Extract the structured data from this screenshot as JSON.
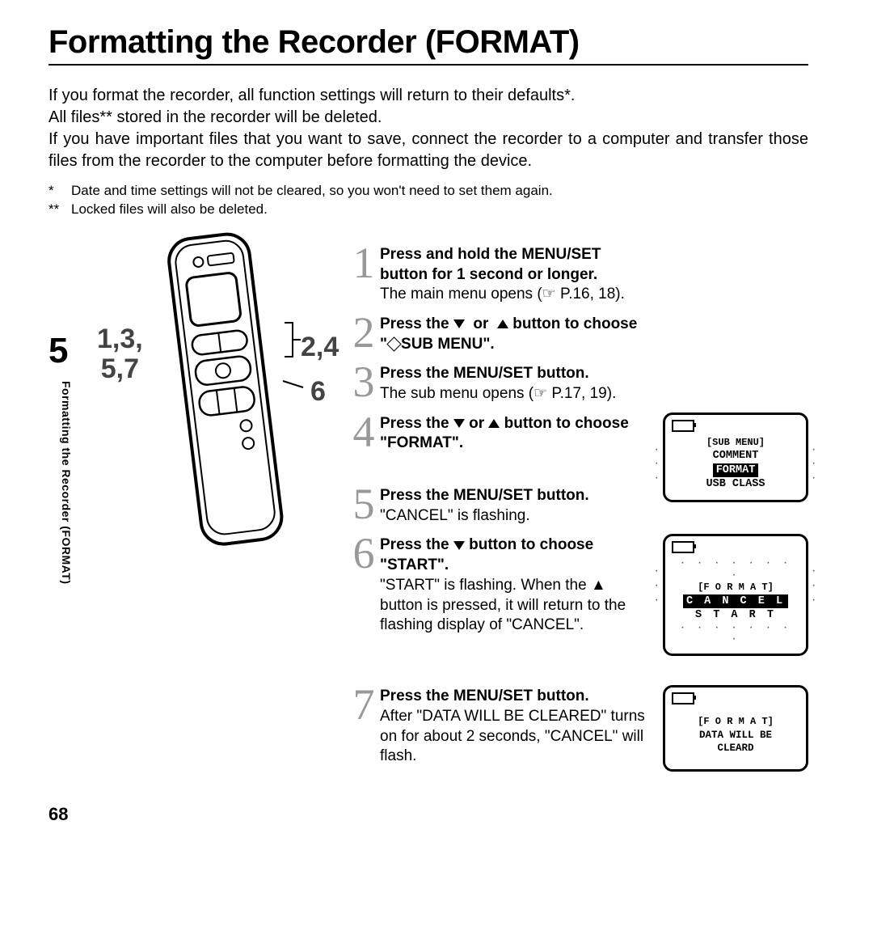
{
  "title": "Formatting the Recorder (FORMAT)",
  "intro_lines": [
    "If you format the recorder, all function settings will return to their defaults*.",
    "All files** stored in the recorder will be deleted.",
    "If you have important files that you want to save, connect the recorder to a computer and transfer those files from the recorder to the computer before formatting the device."
  ],
  "footnotes": [
    {
      "mark": "*",
      "text": "Date and time settings will not be cleared, so you won't need to set them again."
    },
    {
      "mark": "**",
      "text": "Locked files will also be deleted."
    }
  ],
  "chapter_number": "5",
  "side_tab": "Formatting the Recorder (FORMAT)",
  "callouts": {
    "left_top": "1,3,",
    "left_bottom": "5,7",
    "right_top": "2,4",
    "right_bottom": "6"
  },
  "steps": [
    {
      "n": "1",
      "head_pre": "Press and hold the ",
      "head_bold": "MENU/SET",
      "head_post": " button for 1 second or longer.",
      "sub": "The main menu opens (☞ P.16, 18)."
    },
    {
      "n": "2",
      "head_pre": "Press the ",
      "arrows": "down-up",
      "head_mid": " button to choose \"",
      "diamond": true,
      "head_post": "SUB MENU\".",
      "sub": ""
    },
    {
      "n": "3",
      "head_pre": "Press the ",
      "head_bold": "MENU/SET",
      "head_post": "  button.",
      "sub": "The sub menu opens (☞ P.17, 19)."
    },
    {
      "n": "4",
      "head_pre": "Press the ",
      "arrows": "down-up",
      "head_mid": " button to choose \"FORMAT\".",
      "sub": ""
    },
    {
      "n": "5",
      "head_pre": "Press the ",
      "head_bold": "MENU/SET",
      "head_post": "  button.",
      "sub": "\"CANCEL\" is flashing."
    },
    {
      "n": "6",
      "head_pre": "Press the ",
      "arrows": "down",
      "head_mid": " button to choose \"START\".",
      "sub": "\"START\" is flashing. When the ▲ button is pressed, it will return to the flashing display of \"CANCEL\"."
    },
    {
      "n": "7",
      "head_pre": "Press the ",
      "head_bold": "MENU/SET",
      "head_post": " button.",
      "sub": "After \"DATA WILL BE CLEARED\" turns on for about 2 seconds, \"CANCEL\" will flash."
    }
  ],
  "lcds": {
    "a": {
      "title": "[SUB MENU]",
      "row1": "COMMENT",
      "row2_hi": "FORMAT",
      "row3": "USB CLASS"
    },
    "b": {
      "title": "[F O R M A T]",
      "row1_hi": "C A N C E L",
      "row2": "S T A R T"
    },
    "c": {
      "title": "[F O R M A T]",
      "row1": "DATA WILL BE",
      "row2": "CLEARD"
    }
  },
  "page_number": "68"
}
